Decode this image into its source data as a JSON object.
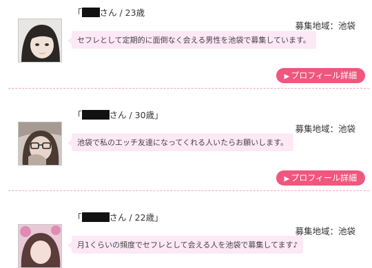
{
  "profiles": [
    {
      "title_prefix": "「",
      "title_suffix": "さん / 23歳",
      "region": "募集地域：池袋",
      "message": "セフレとして定期的に面倒なく会える男性を池袋で募集しています。",
      "button_label": "プロフィール詳細"
    },
    {
      "title_prefix": "「",
      "title_suffix": "さん / 30歳」",
      "region": "募集地域：池袋",
      "message": "池袋で私のエッチ友達になってくれる人いたらお願いします。",
      "button_label": "プロフィール詳細"
    },
    {
      "title_prefix": "「",
      "title_suffix": "さん / 22歳」",
      "region": "募集地域：池袋",
      "message": "月1くらいの頻度でセフレとして会える人を池袋で募集してます♪",
      "button_label": "プロフィール詳細"
    }
  ],
  "colors": {
    "button": "#f0567e",
    "bubble": "#fde8f6",
    "divider": "#f3a5bd"
  }
}
